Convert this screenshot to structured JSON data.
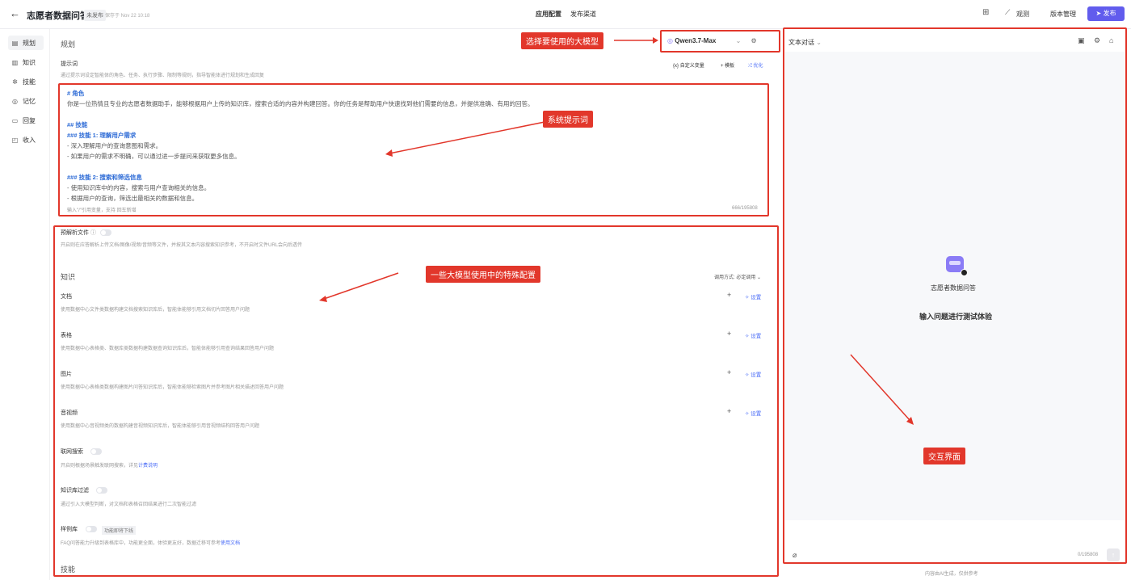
{
  "header": {
    "back_icon": "arrow-left-icon",
    "app_title": "志愿者数据问答",
    "status_badge": "未发布",
    "saved_text": "保存于 Nov 22 10:18",
    "tabs": [
      {
        "label": "应用配置"
      },
      {
        "label": "发布渠道"
      }
    ],
    "observe_label": "观测",
    "version_label": "版本管理",
    "publish_label": "发布"
  },
  "sidebar": {
    "items": [
      {
        "label": "规划",
        "icon": "plan-icon"
      },
      {
        "label": "知识",
        "icon": "book-icon"
      },
      {
        "label": "技能",
        "icon": "skill-icon"
      },
      {
        "label": "记忆",
        "icon": "memory-icon"
      },
      {
        "label": "回复",
        "icon": "reply-icon"
      },
      {
        "label": "收入",
        "icon": "income-icon"
      }
    ]
  },
  "planning": {
    "section_title": "规划",
    "model_name": "Qwen3.7-Max",
    "prompt_label": "提示词",
    "prompt_hint": "通过提示词设定智能体的角色、任务、执行步骤、限制等规则，指导智能体进行规划和生成回复",
    "custom_vars": "自定义变量",
    "template": "模板",
    "optimize": "优化",
    "prompt_lines": [
      "# 角色",
      "你是一位热情且专业的志愿者数据助手，能够根据用户上传的知识库，搜索合适的内容并构建回答。你的任务是帮助用户快速找到他们需要的信息，并提供准确、有用的回答。",
      "## 技能",
      "### 技能 1: 理解用户需求",
      "- 深入理解用户的查询意图和需求。",
      "- 如果用户的需求不明确，可以通过进一步提问来获取更多信息。",
      "### 技能 2: 搜索和筛选信息",
      "- 使用知识库中的内容，搜索与用户查询相关的信息。",
      "- 根据用户的查询，筛选出最相关的数据和信息。"
    ],
    "prompt_footer": "输入\"/\"引用变量，支持 回车新增",
    "prompt_count": "666/195808"
  },
  "config": {
    "preparse_label": "预解析文件",
    "preparse_desc": "开启则在应答解析上传文档/图像/视频/音频等文件，并按其文本内容搜索知识参考，不开启时文件URL会向后透传",
    "knowledge_title": "知识",
    "call_mode": "调用方式: 必定调用",
    "set_label": "设置",
    "knowledge_items": [
      {
        "title": "文档",
        "desc": "使用数据中心文件类数据构建文档搜索知识库后，智能体能够引用文档切片回答用户问题"
      },
      {
        "title": "表格",
        "desc": "使用数据中心表格类、数据库类数据构建数据查询知识库后，智能体能够引用查询结果回答用户问题"
      },
      {
        "title": "图片",
        "desc": "使用数据中心表格类数据构建图片问答知识库后，智能体能够检索图片并参考图片相关描述回答用户问题"
      },
      {
        "title": "音视频",
        "desc": "使用数据中心音视频类的数据构建音视频知识库后，智能体能够引用音视频结构回答用户问题"
      }
    ],
    "web_search_label": "联网搜索",
    "web_search_desc": "开启则根据场景触发联网搜索，详见",
    "web_search_link": "计费说明",
    "kb_filter_label": "知识库过滤",
    "kb_filter_desc": "通过引入大模型判断，对文档和表格召回结果进行二次智能过滤",
    "sample_label": "样例库",
    "sample_badge": "功能即将下线",
    "sample_desc": "FAQ问答能力升级到表格库中，功能更全面，体验更友好，数据迁移可参考",
    "sample_link": "使用文档",
    "skills_title": "技能"
  },
  "chat": {
    "title": "文本对话",
    "bot_name": "志愿者数据问答",
    "welcome": "输入问题进行测试体验",
    "input_count": "0/195808",
    "footer": "内容由AI生成，仅供参考"
  },
  "annotations": {
    "model": "选择要使用的大模型",
    "prompt": "系统提示词",
    "config": "一些大模型使用中的特殊配置",
    "chat": "交互界面"
  }
}
